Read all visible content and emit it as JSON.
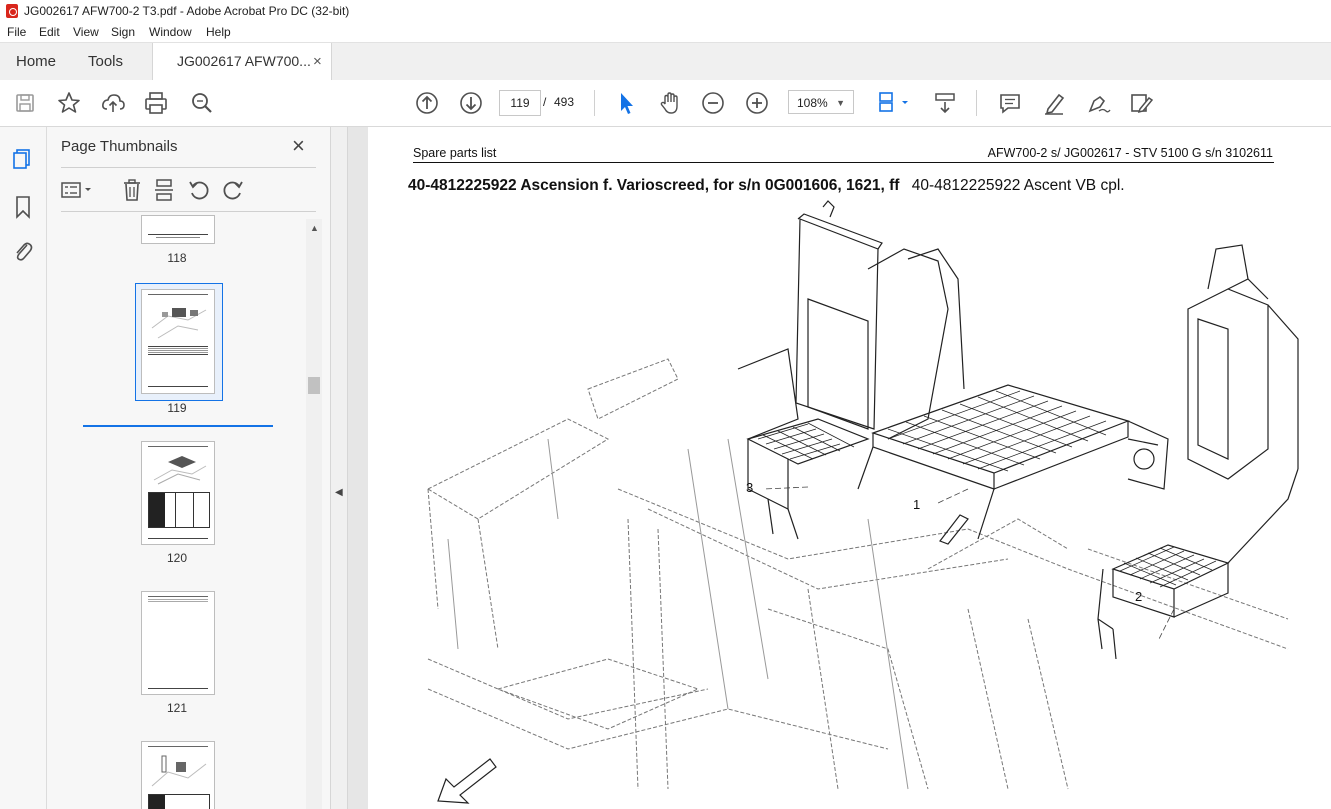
{
  "window": {
    "title": "JG002617 AFW700-2 T3.pdf - Adobe Acrobat Pro DC (32-bit)"
  },
  "menu": [
    "File",
    "Edit",
    "View",
    "Sign",
    "Window",
    "Help"
  ],
  "tabs": {
    "home": "Home",
    "tools": "Tools",
    "document": "JG002617 AFW700...",
    "close": "×"
  },
  "toolbar": {
    "current_page": "119",
    "page_separator": "/",
    "page_count": "493",
    "zoom": "108%"
  },
  "icons": {
    "save": "save-icon",
    "bookmark": "star-icon",
    "upload": "upload-icon",
    "print": "print-icon",
    "find": "zoom-search-icon",
    "prev": "arrow-up-circle-icon",
    "next": "arrow-down-circle-icon",
    "select": "cursor-icon",
    "hand": "hand-icon",
    "zoom_out": "zoom-out-icon",
    "zoom_in": "zoom-in-icon"
  },
  "thumbnail_panel": {
    "title": "Page Thumbnails",
    "close": "×",
    "pages": [
      {
        "label": "118"
      },
      {
        "label": "119",
        "selected": true
      },
      {
        "label": "120"
      },
      {
        "label": "121"
      }
    ]
  },
  "document": {
    "header_left": "Spare parts list",
    "header_right": "AFW700-2 s/ JG002617 - STV 5100 G s/n 3102611",
    "title_bold": "40-4812225922 Ascension f. Varioscreed, for s/n 0G001606, 1621, ff",
    "title_regular": "40-4812225922 Ascent VB cpl.",
    "callouts": [
      "1",
      "2",
      "3"
    ]
  },
  "colors": {
    "accent": "#1473e6",
    "pdf_red": "#d9261c",
    "icon_gray": "#505050"
  }
}
